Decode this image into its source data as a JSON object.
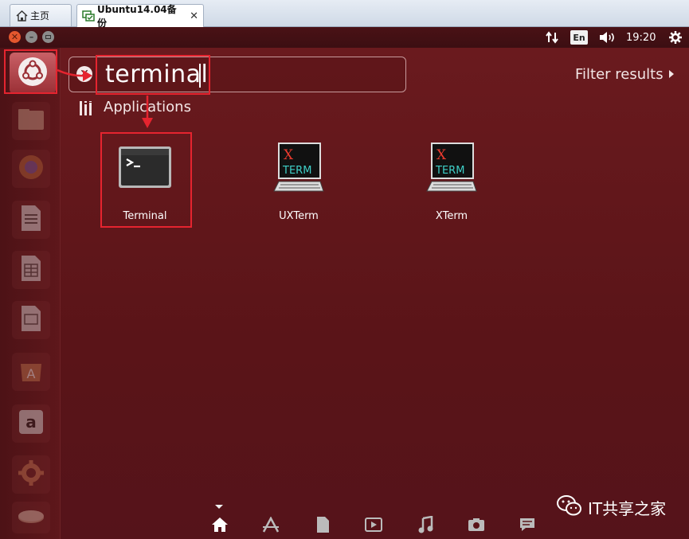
{
  "browser_tabs": [
    {
      "label": "主页",
      "icon": "home-icon"
    },
    {
      "label": "Ubuntu14.04备份",
      "icon": "vm-icon",
      "close": "✕"
    }
  ],
  "panel": {
    "window_controls": {
      "close": "✕",
      "minimize": "–",
      "maximize": "▢"
    },
    "language": "En",
    "time": "19:20",
    "icons": [
      "network-icon",
      "volume-icon",
      "settings-icon"
    ]
  },
  "launcher": {
    "items": [
      "dash-home-icon",
      "files-icon",
      "firefox-icon",
      "writer-icon",
      "calc-icon",
      "impress-icon",
      "software-center-icon",
      "amazon-icon",
      "system-settings-icon",
      "disc-icon"
    ]
  },
  "dash": {
    "search": {
      "value": "terminal",
      "clear_label": "✕"
    },
    "filter_results": "Filter results",
    "section": "Applications",
    "apps": [
      {
        "name": "Terminal",
        "icon": "terminal-icon"
      },
      {
        "name": "UXTerm",
        "icon": "xterm-icon",
        "logo_x": "X",
        "logo_term": "TERM"
      },
      {
        "name": "XTerm",
        "icon": "xterm-icon",
        "logo_x": "X",
        "logo_term": "TERM"
      }
    ],
    "lenses": [
      "home-lens-icon",
      "applications-lens-icon",
      "files-lens-icon",
      "video-lens-icon",
      "music-lens-icon",
      "photos-lens-icon",
      "social-lens-icon"
    ]
  },
  "watermark": {
    "text": "IT共享之家",
    "icon": "wechat-icon"
  },
  "colors": {
    "accent": "#e5242f",
    "background": "#5a1418",
    "panel": "#3c0e12"
  }
}
